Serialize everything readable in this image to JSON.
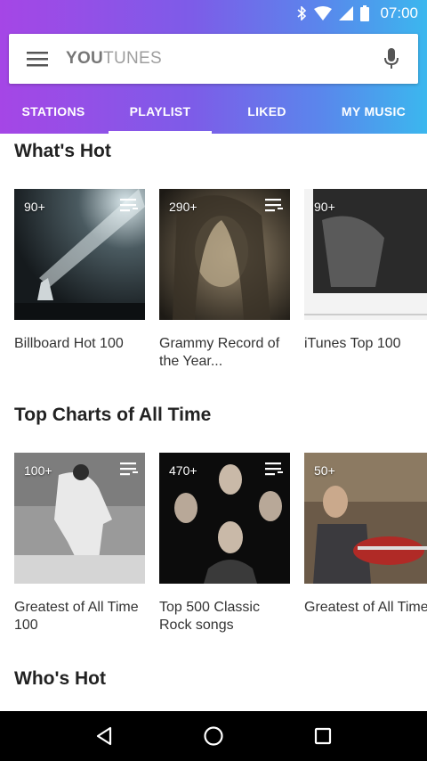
{
  "status": {
    "time": "07:00",
    "icons": [
      "bluetooth-icon",
      "wifi-icon",
      "signal-icon",
      "battery-icon"
    ]
  },
  "search": {
    "brand_bold": "YOU",
    "brand_light": "TUNES",
    "menu_icon": "hamburger-menu-icon",
    "mic_icon": "mic-icon"
  },
  "tabs": [
    {
      "label": "STATIONS",
      "active": false
    },
    {
      "label": "PLAYLIST",
      "active": true
    },
    {
      "label": "LIKED",
      "active": false
    },
    {
      "label": "MY MUSIC",
      "active": false
    }
  ],
  "sections": [
    {
      "title": "What's Hot",
      "cards": [
        {
          "count": "90+",
          "label": "Billboard Hot 100"
        },
        {
          "count": "290+",
          "label": "Grammy Record of the Year..."
        },
        {
          "count": "90+",
          "label": "iTunes Top 100"
        }
      ]
    },
    {
      "title": "Top Charts of All Time",
      "cards": [
        {
          "count": "100+",
          "label": "Greatest of All Time 100"
        },
        {
          "count": "470+",
          "label": "Top 500 Classic Rock songs"
        },
        {
          "count": "50+",
          "label": "Greatest of All Time Pop"
        }
      ]
    },
    {
      "title": "Who's Hot",
      "cards": []
    }
  ],
  "colors": {
    "gradient_start": "#a546e6",
    "gradient_end": "#3bb7ee",
    "title_text": "#222222"
  },
  "navigation": {
    "back_icon": "back-triangle-icon",
    "home_icon": "home-circle-icon",
    "recents_icon": "recents-square-icon"
  }
}
